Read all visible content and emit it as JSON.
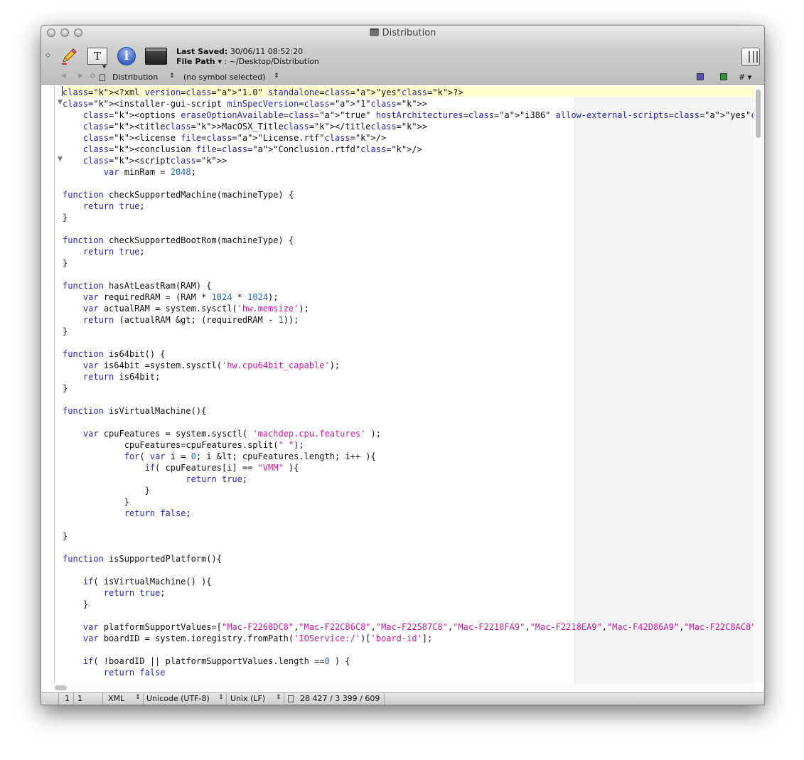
{
  "window": {
    "title": "Distribution"
  },
  "toolbar": {
    "diamond": "◇",
    "info_glyph": "i",
    "textformat_glyph": "T",
    "last_saved_label": "Last Saved:",
    "last_saved_value": " 30/06/11 08:52:20",
    "file_path_label": "File Path ▾",
    "file_path_value": " : ~/Desktop/Distribution"
  },
  "navbar": {
    "back": "◀",
    "forward": "▶",
    "doc_name": "Distribution",
    "symbol": "(no symbol selected)",
    "hash_menu": "# ▾"
  },
  "editor": {
    "lines": [
      "<?xml version=\"1.0\" standalone=\"yes\"?>",
      "<installer-gui-script minSpecVersion=\"1\">",
      "    <options eraseOptionAvailable=\"true\" hostArchitectures=\"i386\" allow-external-scripts=\"yes\"/>",
      "    <title>MacOSX_Title</title>",
      "    <license file=\"License.rtf\"/>",
      "    <conclusion file=\"Conclusion.rtfd\"/>",
      "    <script>",
      "        var minRam = 2048;",
      "",
      "function checkSupportedMachine(machineType) {",
      "    return true;",
      "}",
      "",
      "function checkSupportedBootRom(machineType) {",
      "    return true;",
      "}",
      "",
      "function hasAtLeastRam(RAM) {",
      "    var requiredRAM = (RAM * 1024 * 1024);",
      "    var actualRAM = system.sysctl('hw.memsize');",
      "    return (actualRAM &gt; (requiredRAM - 1));",
      "}",
      "",
      "function is64bit() {",
      "    var is64bit =system.sysctl('hw.cpu64bit_capable');",
      "    return is64bit;",
      "}",
      "",
      "function isVirtualMachine(){",
      "",
      "    var cpuFeatures = system.sysctl( 'machdep.cpu.features' );",
      "            cpuFeatures=cpuFeatures.split(\" \");",
      "            for( var i = 0; i &lt; cpuFeatures.length; i++ ){",
      "                if( cpuFeatures[i] == \"VMM\" ){",
      "                        return true;",
      "                }",
      "            }",
      "            return false;",
      "",
      "}",
      "",
      "function isSupportedPlatform(){",
      "",
      "    if( isVirtualMachine() ){",
      "        return true;",
      "    }",
      "",
      "    var platformSupportValues=[\"Mac-F2268DC8\",\"Mac-F22C86C8\",\"Mac-F22587C8\",\"Mac-F2218FA9\",\"Mac-F2218EA9\",\"Mac-F42D86A9\",\"Mac-F22C8AC8\"",
      "    var boardID = system.ioregistry.fromPath('IOService:/')['board-id'];",
      "",
      "    if( !boardID || platformSupportValues.length ==0 ) {",
      "        return false"
    ]
  },
  "statusbar": {
    "line": "1",
    "column": "1",
    "syntax": "XML",
    "encoding": "Unicode (UTF-8)",
    "line_endings": "Unix (LF)",
    "counts": "28 427 / 3 399 / 609"
  }
}
